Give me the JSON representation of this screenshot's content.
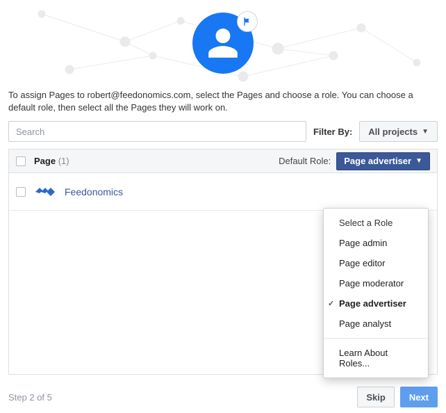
{
  "instructions": "To assign Pages to robert@feedonomics.com, select the Pages and choose a role. You can choose a default role, then select all the Pages they will work on.",
  "search": {
    "placeholder": "Search"
  },
  "filter": {
    "label": "Filter By:",
    "button": "All projects"
  },
  "table": {
    "header_label": "Page",
    "count_label": "(1)",
    "default_role_label": "Default Role:",
    "role_picker_value": "Page advertiser",
    "rows": [
      {
        "name": "Feedonomics"
      }
    ]
  },
  "dropdown": {
    "header": "Select a Role",
    "options": [
      {
        "label": "Page admin",
        "selected": false
      },
      {
        "label": "Page editor",
        "selected": false
      },
      {
        "label": "Page moderator",
        "selected": false
      },
      {
        "label": "Page advertiser",
        "selected": true
      },
      {
        "label": "Page analyst",
        "selected": false
      }
    ],
    "learn": "Learn About Roles..."
  },
  "footer": {
    "step": "Step 2 of 5",
    "skip": "Skip",
    "next": "Next"
  }
}
